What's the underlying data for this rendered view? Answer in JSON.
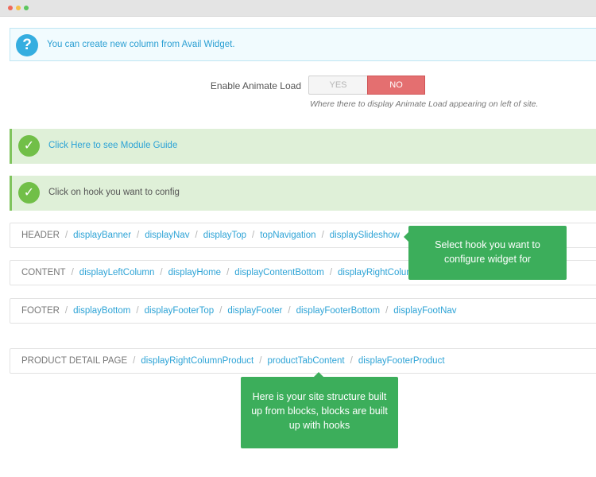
{
  "colors": {
    "info_blue": "#35aee0",
    "link_blue": "#2da3d6",
    "success_green": "#71bf48",
    "tooltip_green": "#3cae5b",
    "no_red": "#e46f70",
    "window_dots": [
      "#ef6a5a",
      "#f5c04a",
      "#5cc65e"
    ]
  },
  "info_alert": {
    "icon": "question-icon",
    "text": "You can create new column from Avail Widget."
  },
  "animate_load": {
    "label": "Enable Animate Load",
    "yes": "YES",
    "no": "NO",
    "selected": "NO",
    "help": "Where there to display Animate Load appearing on left of site."
  },
  "alerts": [
    {
      "icon": "check-icon",
      "text": "Click Here to see Module Guide"
    },
    {
      "icon": "check-icon",
      "text": "Click on hook you want to config"
    }
  ],
  "sections": [
    {
      "name": "HEADER",
      "hooks": [
        "displayBanner",
        "displayNav",
        "displayTop",
        "topNavigation",
        "displaySlideshow"
      ]
    },
    {
      "name": "CONTENT",
      "hooks": [
        "displayLeftColumn",
        "displayHome",
        "displayContentBottom",
        "displayRightColumn"
      ]
    },
    {
      "name": "FOOTER",
      "hooks": [
        "displayBottom",
        "displayFooterTop",
        "displayFooter",
        "displayFooterBottom",
        "displayFootNav"
      ]
    },
    {
      "name": "PRODUCT DETAIL PAGE",
      "hooks": [
        "displayRightColumnProduct",
        "productTabContent",
        "displayFooterProduct"
      ]
    }
  ],
  "tooltips": {
    "select_hook": "Select hook you want to configure widget for",
    "site_structure": "Here is your site structure built up from blocks, blocks are built up with hooks"
  }
}
